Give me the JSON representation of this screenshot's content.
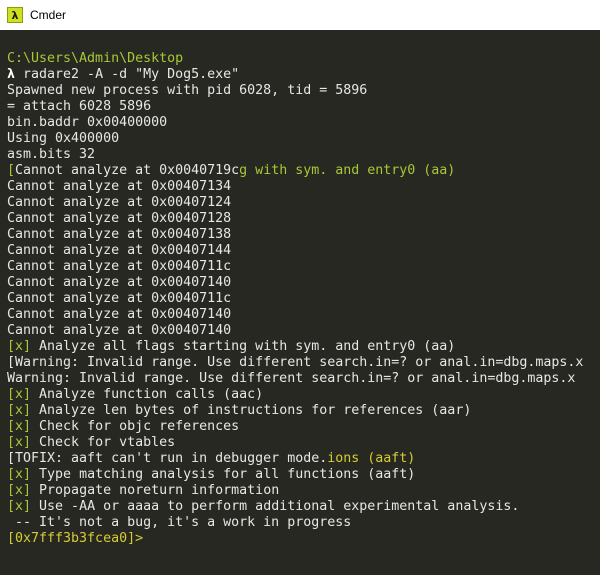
{
  "window": {
    "title": "Cmder",
    "icon": "lambda-icon",
    "icon_glyph": "λ"
  },
  "colors": {
    "background": "#272822",
    "text": "#e6e6e6",
    "green": "#a6c837",
    "yellow": "#d7cd32"
  },
  "terminal": {
    "lines": [
      [
        {
          "t": "C:\\Users\\Admin\\Desktop",
          "c": "green"
        }
      ],
      [
        {
          "t": "λ ",
          "c": "bold"
        },
        {
          "t": "radare2 -A -d \"My Dog5.exe\""
        }
      ],
      [
        {
          "t": "Spawned new process with pid 6028, tid = 5896"
        }
      ],
      [
        {
          "t": "= attach 6028 5896"
        }
      ],
      [
        {
          "t": "bin.baddr 0x00400000"
        }
      ],
      [
        {
          "t": "Using 0x400000"
        }
      ],
      [
        {
          "t": "asm.bits 32"
        }
      ],
      [
        {
          "t": "[",
          "c": "green"
        },
        {
          "t": "Cannot analyze at 0x0040719c"
        },
        {
          "t": "g with sym. and entry0 (aa)",
          "c": "green"
        }
      ],
      [
        {
          "t": "Cannot analyze at 0x00407134"
        }
      ],
      [
        {
          "t": "Cannot analyze at 0x00407124"
        }
      ],
      [
        {
          "t": "Cannot analyze at 0x00407128"
        }
      ],
      [
        {
          "t": "Cannot analyze at 0x00407138"
        }
      ],
      [
        {
          "t": "Cannot analyze at 0x00407144"
        }
      ],
      [
        {
          "t": "Cannot analyze at 0x0040711c"
        }
      ],
      [
        {
          "t": "Cannot analyze at 0x00407140"
        }
      ],
      [
        {
          "t": "Cannot analyze at 0x0040711c"
        }
      ],
      [
        {
          "t": "Cannot analyze at 0x00407140"
        }
      ],
      [
        {
          "t": "Cannot analyze at 0x00407140"
        }
      ],
      [
        {
          "t": "[x]",
          "c": "green"
        },
        {
          "t": " Analyze all flags starting with sym. and entry0 (aa)"
        }
      ],
      [
        {
          "t": "[Warning: Invalid range. Use different search.in=? or anal.in=dbg.maps.x"
        }
      ],
      [
        {
          "t": "Warning: Invalid range. Use different search.in=? or anal.in=dbg.maps.x"
        }
      ],
      [
        {
          "t": "[x]",
          "c": "green"
        },
        {
          "t": " Analyze function calls (aac)"
        }
      ],
      [
        {
          "t": "[x]",
          "c": "green"
        },
        {
          "t": " Analyze len bytes of instructions for references (aar)"
        }
      ],
      [
        {
          "t": "[x]",
          "c": "green"
        },
        {
          "t": " Check for objc references"
        }
      ],
      [
        {
          "t": "[x]",
          "c": "green"
        },
        {
          "t": " Check for vtables"
        }
      ],
      [
        {
          "t": "[TOFIX: aaft can't run in debugger mode."
        },
        {
          "t": "ions (aaft)",
          "c": "yellow"
        }
      ],
      [
        {
          "t": "[x]",
          "c": "green"
        },
        {
          "t": " Type matching analysis for all functions (aaft)"
        }
      ],
      [
        {
          "t": "[x]",
          "c": "green"
        },
        {
          "t": " Propagate noreturn information"
        }
      ],
      [
        {
          "t": "[x]",
          "c": "green"
        },
        {
          "t": " Use -AA or aaaa to perform additional experimental analysis."
        }
      ],
      [
        {
          "t": " -- It's not a bug, it's a work in progress"
        }
      ],
      [
        {
          "t": "[0x7fff3b3fcea0]>",
          "c": "yellow"
        }
      ]
    ]
  }
}
